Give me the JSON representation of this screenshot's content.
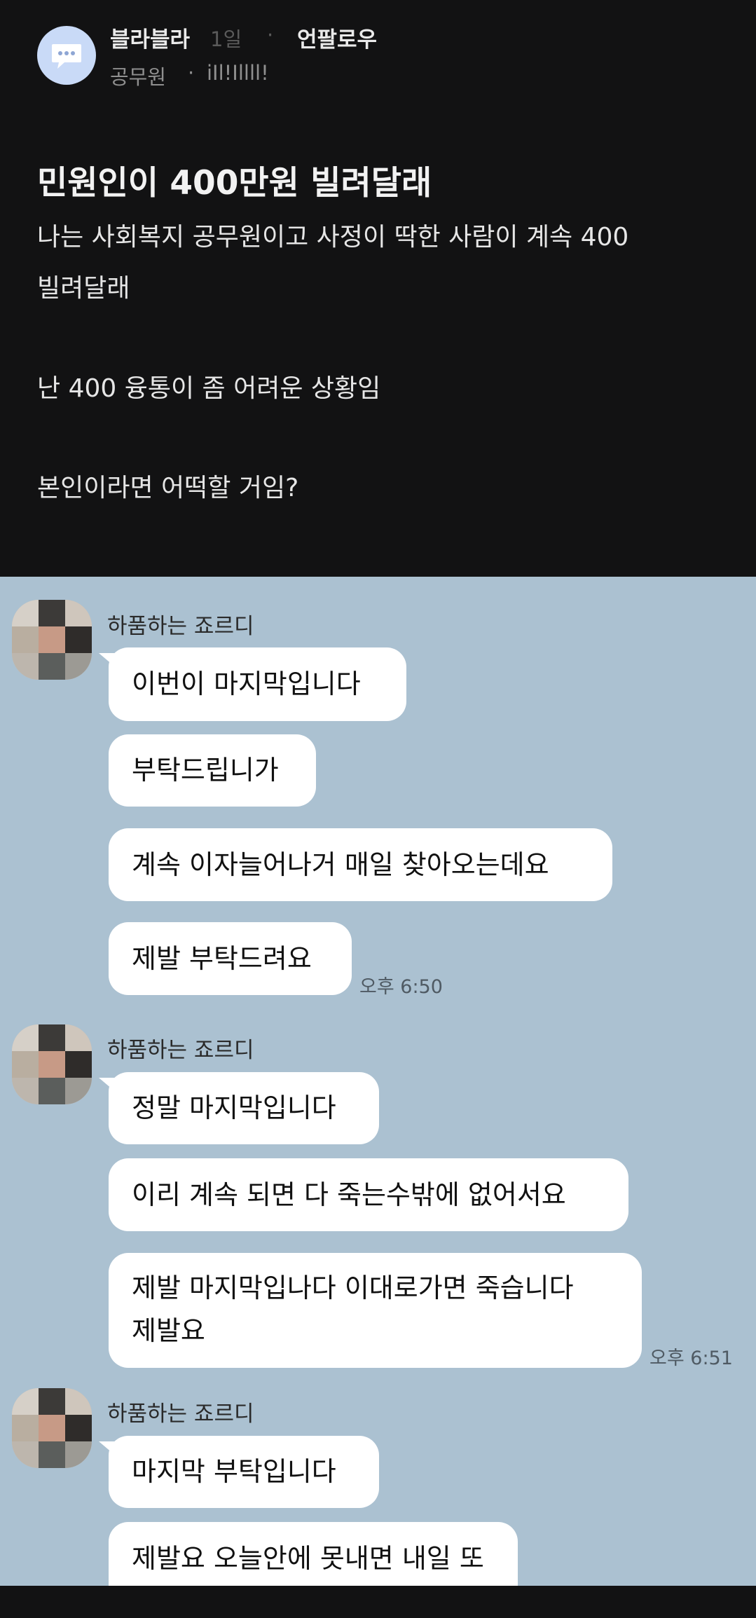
{
  "post": {
    "author": "블라블라",
    "time": "1일",
    "separator": "·",
    "unfollow_label": "언팔로우",
    "job": "공무원",
    "job_dot": "·",
    "nickname": "iIl!Illll!",
    "avatar_icon": "speech-bubble-icon",
    "title": "민원인이 400만원 빌려달래",
    "body": [
      "나는 사회복지 공무원이고 사정이 딱한 사람이 계속 400",
      "빌려달래",
      "난 400 융통이 좀 어려운 상황임",
      "본인이라면 어떡할 거임?"
    ]
  },
  "chat": {
    "groups": [
      {
        "sender": "하품하는 죠르디",
        "messages": [
          {
            "lines": [
              "이번이 마지막입니다"
            ]
          },
          {
            "lines": [
              "부탁드립니가"
            ]
          },
          {
            "lines": [
              "계속 이자늘어나거 매일 찾아오는데요"
            ]
          },
          {
            "lines": [
              "제발 부탁드려요"
            ]
          }
        ],
        "timestamp": "오후 6:50"
      },
      {
        "sender": "하품하는 죠르디",
        "messages": [
          {
            "lines": [
              "정말 마지막입니다"
            ]
          },
          {
            "lines": [
              "이리 계속 되면 다 죽는수밖에 없어서요"
            ]
          },
          {
            "lines": [
              "제발 마지막입나다 이대로가면 죽습니다",
              "제발요"
            ]
          }
        ],
        "timestamp": "오후 6:51"
      },
      {
        "sender": "하품하는 죠르디",
        "messages": [
          {
            "lines": [
              "마지막 부탁입니다"
            ]
          },
          {
            "lines": [
              "제발요 오늘안에 못내면 내일 또"
            ]
          }
        ],
        "timestamp": ""
      }
    ]
  },
  "colors": {
    "post_background": "#121213",
    "chat_background": "#abc1d1",
    "bubble": "#ffffff",
    "avatar_background": "#c9daf7"
  }
}
